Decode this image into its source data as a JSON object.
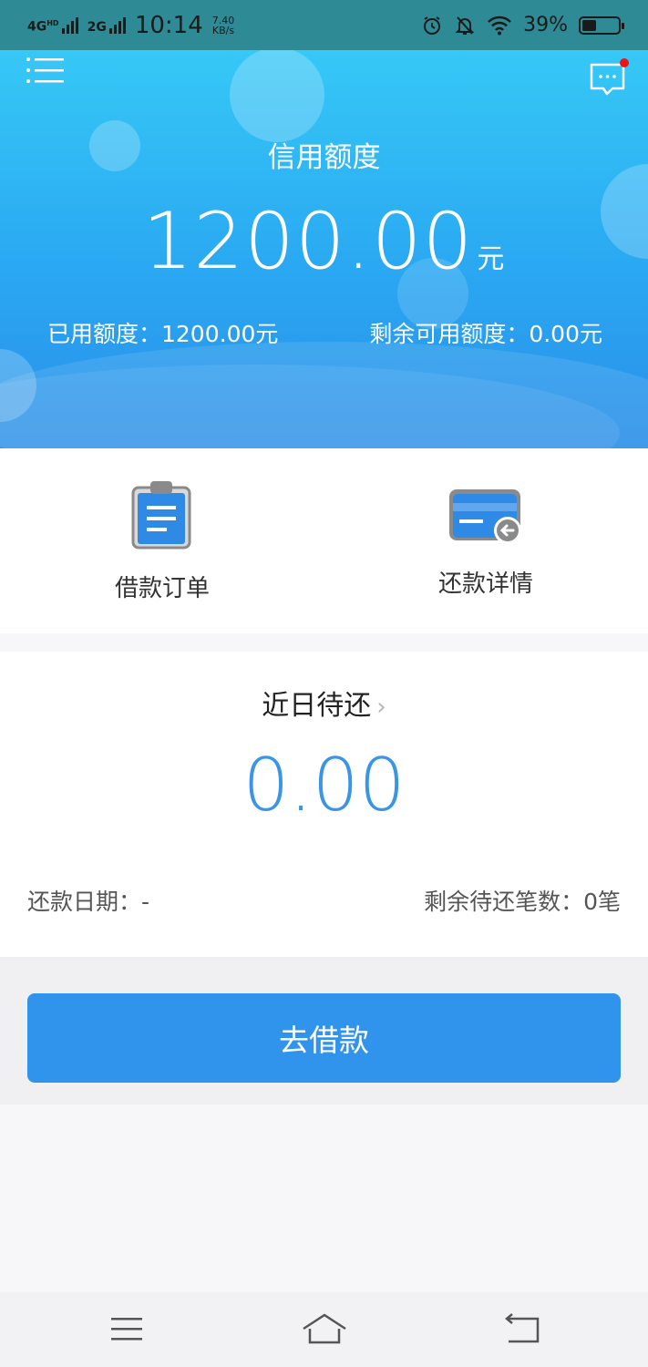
{
  "status_bar": {
    "network_1": "4G",
    "network_1_sup": "HD",
    "network_2": "2G",
    "time": "10:14",
    "speed_value": "7.40",
    "speed_unit": "KB/s",
    "battery_level": "39%",
    "battery_fraction": 0.39
  },
  "header": {
    "title": "信用额度",
    "amount": "1200.00",
    "amount_unit": "元",
    "used_label": "已用额度：1200.00元",
    "remaining_label": "剩余可用额度：0.00元",
    "menu_icon": "menu-icon",
    "message_icon": "message-icon"
  },
  "actions": [
    {
      "label": "借款订单",
      "icon": "clipboard-icon"
    },
    {
      "label": "还款详情",
      "icon": "card-refund-icon"
    }
  ],
  "repay": {
    "title": "近日待还",
    "chevron": "›",
    "amount": "0.00",
    "date_label": "还款日期：-",
    "count_label": "剩余待还笔数：0笔"
  },
  "borrow_button": {
    "label": "去借款"
  },
  "nav_bar": {
    "icons": [
      "menu-lines-icon",
      "home-icon",
      "back-icon"
    ]
  },
  "colors": {
    "status_bar": "#2e8b96",
    "header_top": "#36c8f6",
    "header_bottom": "#2b8fe8",
    "accent": "#3194ec",
    "amount_blue": "#3a95e6",
    "notification_dot": "#e8151c"
  }
}
